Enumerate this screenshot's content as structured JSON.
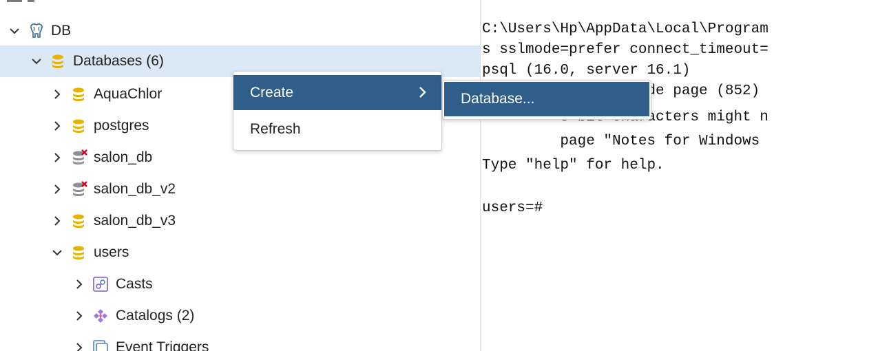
{
  "tree": {
    "server": {
      "label": "DB",
      "icon": "postgres-elephant-icon"
    },
    "databases_node": {
      "label": "Databases (6)"
    },
    "databases": [
      {
        "label": "AquaChlor",
        "icon": "database-icon"
      },
      {
        "label": "postgres",
        "icon": "database-icon"
      },
      {
        "label": "salon_db",
        "icon": "database-disconnected-icon"
      },
      {
        "label": "salon_db_v2",
        "icon": "database-disconnected-icon"
      },
      {
        "label": "salon_db_v3",
        "icon": "database-icon"
      },
      {
        "label": "users",
        "icon": "database-icon"
      }
    ],
    "users_children": [
      {
        "label": "Casts",
        "icon": "casts-icon"
      },
      {
        "label": "Catalogs (2)",
        "icon": "catalogs-icon"
      },
      {
        "label": "Event Triggers",
        "icon": "event-triggers-icon"
      }
    ]
  },
  "context_menu": {
    "items": [
      {
        "label": "Create",
        "has_submenu": true,
        "active": true
      },
      {
        "label": "Refresh",
        "has_submenu": false,
        "active": false
      }
    ],
    "submenu": {
      "items": [
        {
          "label": "Database..."
        }
      ]
    }
  },
  "terminal": {
    "lines": [
      "C:\\Users\\Hp\\AppData\\Local\\Program",
      "s sslmode=prefer connect_timeout=",
      "psql (16.0, server 16.1)",
      "WARNING: Console code page (852)",
      "         8-bit characters might n",
      "         page \"Notes for Windows",
      "Type \"help\" for help.",
      "",
      "users=#"
    ]
  },
  "colors": {
    "selection_bg": "#dbe9f7",
    "menu_active_bg": "#2f5e8a",
    "database_icon": "#e6b400",
    "disconnected_icon": "#8a8f96",
    "error_mark": "#d0021b"
  }
}
